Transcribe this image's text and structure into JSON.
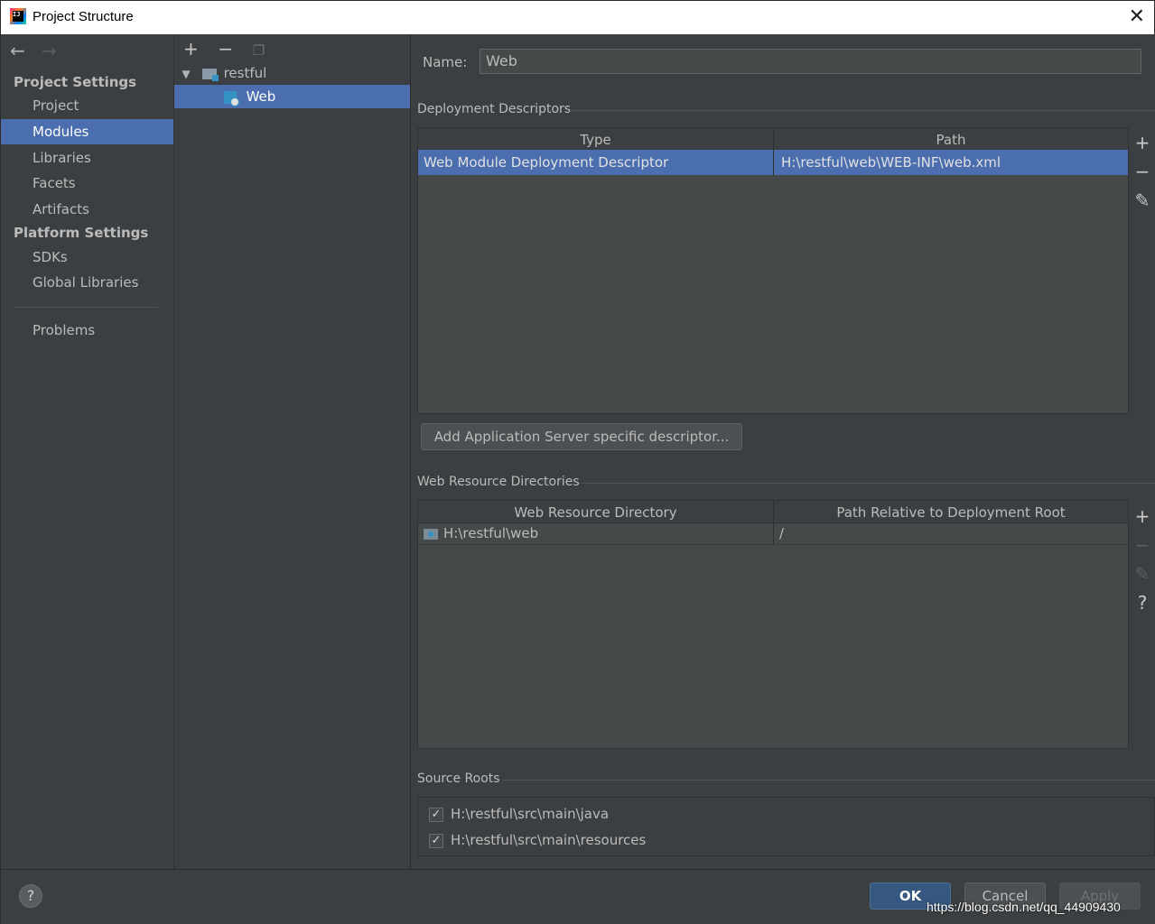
{
  "window": {
    "title": "Project Structure",
    "close_glyph": "✕"
  },
  "nav": {
    "back_glyph": "←",
    "forward_glyph": "→",
    "project_settings_heading": "Project Settings",
    "platform_settings_heading": "Platform Settings",
    "items": {
      "project": "Project",
      "modules": "Modules",
      "libraries": "Libraries",
      "facets": "Facets",
      "artifacts": "Artifacts",
      "sdks": "SDKs",
      "global_libraries": "Global Libraries",
      "problems": "Problems"
    },
    "selected": "Modules"
  },
  "tree": {
    "toolbar": {
      "add": "+",
      "remove": "−",
      "copy": "❐"
    },
    "expander": "▼",
    "root": "restful",
    "child": "Web"
  },
  "facet": {
    "name_label": "Name:",
    "name_value": "Web",
    "deployment": {
      "heading": "Deployment Descriptors",
      "columns": [
        "Type",
        "Path"
      ],
      "rows": [
        {
          "type": "Web Module Deployment Descriptor",
          "path": "H:\\restful\\web\\WEB-INF\\web.xml"
        }
      ],
      "tools": {
        "add": "+",
        "remove": "−",
        "edit": "✎"
      },
      "add_server_button": "Add Application Server specific descriptor..."
    },
    "web_resources": {
      "heading": "Web Resource Directories",
      "columns": [
        "Web Resource Directory",
        "Path Relative to Deployment Root"
      ],
      "rows": [
        {
          "directory": "H:\\restful\\web",
          "relative": "/"
        }
      ],
      "tools": {
        "add": "+",
        "remove": "−",
        "edit": "✎",
        "help": "?"
      }
    },
    "source_roots": {
      "heading": "Source Roots",
      "check_glyph": "✓",
      "items": [
        {
          "path": "H:\\restful\\src\\main\\java",
          "checked": true
        },
        {
          "path": "H:\\restful\\src\\main\\resources",
          "checked": true
        }
      ]
    }
  },
  "footer": {
    "help": "?",
    "ok": "OK",
    "cancel": "Cancel",
    "apply": "Apply",
    "watermark": "https://blog.csdn.net/qq_44909430"
  }
}
